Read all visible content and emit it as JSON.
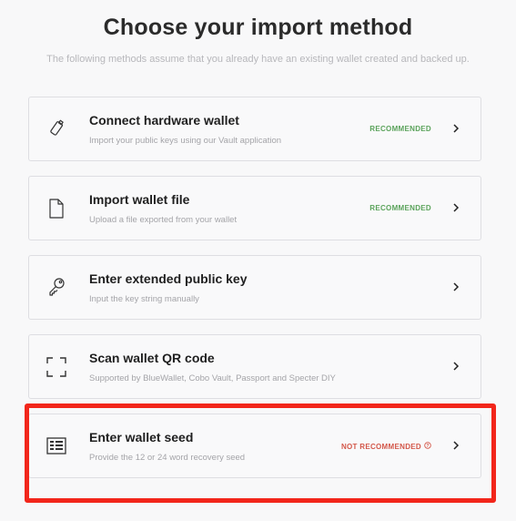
{
  "header": {
    "title": "Choose your import method",
    "subtitle": "The following methods assume that you already have an existing wallet created and backed up."
  },
  "methods": [
    {
      "title": "Connect hardware wallet",
      "description": "Import your public keys using our Vault application",
      "badge": "RECOMMENDED",
      "icon": "usb-stick-icon"
    },
    {
      "title": "Import wallet file",
      "description": "Upload a file exported from your wallet",
      "badge": "RECOMMENDED",
      "icon": "file-icon"
    },
    {
      "title": "Enter extended public key",
      "description": "Input the key string manually",
      "badge": "",
      "icon": "key-icon"
    },
    {
      "title": "Scan wallet QR code",
      "description": "Supported by BlueWallet, Cobo Vault, Passport and Specter DIY",
      "badge": "",
      "icon": "qr-scan-icon"
    },
    {
      "title": "Enter wallet seed",
      "description": "Provide the 12 or 24 word recovery seed",
      "badge": "NOT RECOMMENDED",
      "icon": "seed-grid-icon"
    }
  ],
  "colors": {
    "recommended": "#5ba35b",
    "not_recommended": "#d35749",
    "highlight": "#f2261b"
  }
}
